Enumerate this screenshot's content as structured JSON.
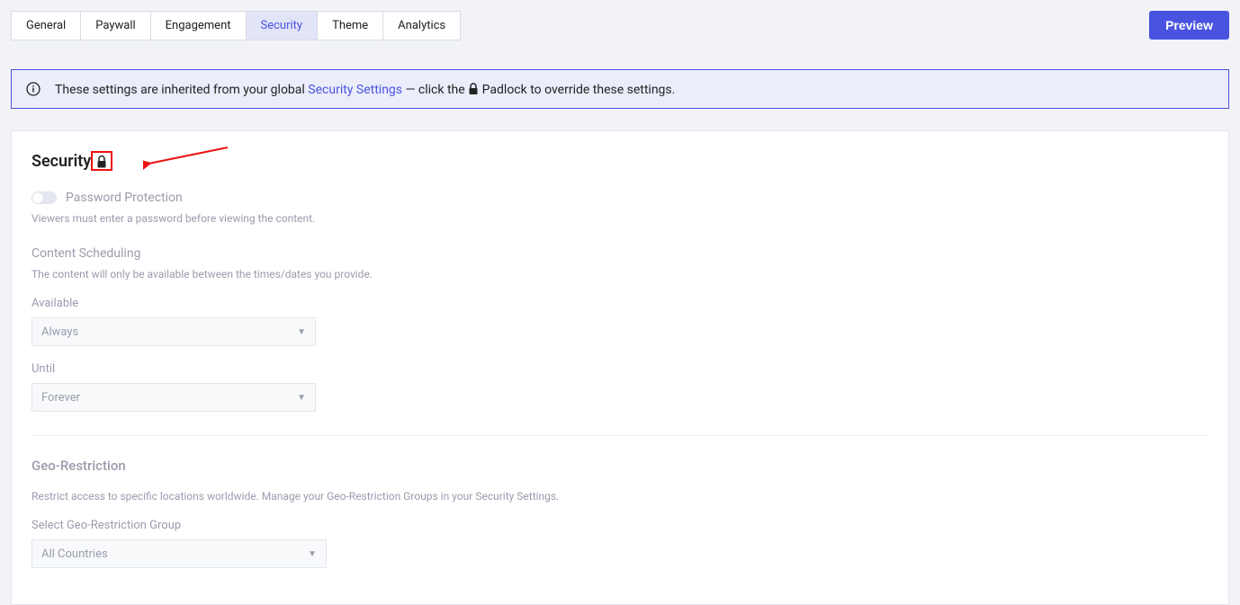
{
  "header": {
    "tabs": [
      {
        "label": "General"
      },
      {
        "label": "Paywall"
      },
      {
        "label": "Engagement"
      },
      {
        "label": "Security",
        "active": true
      },
      {
        "label": "Theme"
      },
      {
        "label": "Analytics"
      }
    ],
    "preview_label": "Preview"
  },
  "banner": {
    "pre": "These settings are inherited from your global",
    "link": "Security Settings",
    "mid": "— click the",
    "post": "Padlock to override these settings."
  },
  "security": {
    "title": "Security",
    "password": {
      "label": "Password Protection",
      "helper": "Viewers must enter a password before viewing the content."
    },
    "scheduling": {
      "title": "Content Scheduling",
      "helper": "The content will only be available between the times/dates you provide.",
      "available_label": "Available",
      "available_value": "Always",
      "until_label": "Until",
      "until_value": "Forever"
    },
    "geo": {
      "title": "Geo-Restriction",
      "helper": "Restrict access to specific locations worldwide. Manage your Geo-Restriction Groups in your Security Settings.",
      "select_label": "Select Geo-Restriction Group",
      "select_value": "All Countries"
    }
  }
}
